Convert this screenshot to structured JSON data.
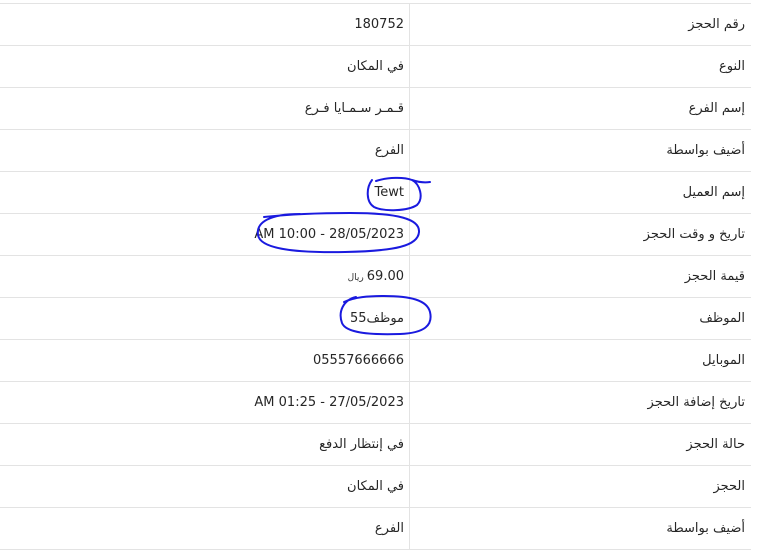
{
  "rows": [
    {
      "label": "رقم الحجز",
      "value": "180752"
    },
    {
      "label": "النوع",
      "value": "في المكان"
    },
    {
      "label": "إسم الفرع",
      "value": "قـمـر سـمـايا فـرع"
    },
    {
      "label": "أضيف بواسطة",
      "value": "الفرع"
    },
    {
      "label": "إسم العميل",
      "value": "Tewt"
    },
    {
      "label": "تاريخ و وقت الحجز",
      "value": "AM 10:00 - 28/05/2023"
    },
    {
      "label": "قيمة الحجز",
      "value": "69.00",
      "currency": "ريال"
    },
    {
      "label": "الموظف",
      "value": "موظف55"
    },
    {
      "label": "الموبايل",
      "value": "05557666666"
    },
    {
      "label": "تاريخ إضافة الحجز",
      "value": "AM 01:25 - 27/05/2023"
    },
    {
      "label": "حالة الحجز",
      "value": "في إنتظار الدفع"
    },
    {
      "label": "الحجز",
      "value": "في المكان"
    },
    {
      "label": "أضيف بواسطة",
      "value": "الفرع"
    }
  ],
  "annotations": {
    "circle_color": "#1a1adf",
    "circled_rows": [
      "إسم العميل",
      "تاريخ و وقت الحجز",
      "الموظف"
    ]
  }
}
